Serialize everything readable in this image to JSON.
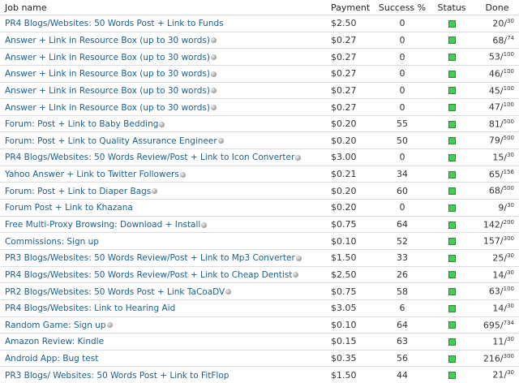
{
  "headers": {
    "job": "Job name",
    "payment": "Payment",
    "success": "Success %",
    "status": "Status",
    "done": "Done"
  },
  "colors": {
    "link": "#1a5f8b",
    "status_ok": "#44cc55"
  },
  "rows": [
    {
      "job": "PR4 Blogs/Websites: 50 Words Post + Link to Funds",
      "info": false,
      "payment": "$2.50",
      "success": "0",
      "done": "20",
      "total": "30"
    },
    {
      "job": "Answer + Link in Resource Box (up to 30 words)",
      "info": true,
      "payment": "$0.27",
      "success": "0",
      "done": "68",
      "total": "74"
    },
    {
      "job": "Answer + Link in Resource Box (up to 30 words)",
      "info": true,
      "payment": "$0.27",
      "success": "0",
      "done": "53",
      "total": "100"
    },
    {
      "job": "Answer + Link in Resource Box (up to 30 words)",
      "info": true,
      "payment": "$0.27",
      "success": "0",
      "done": "46",
      "total": "100"
    },
    {
      "job": "Answer + Link in Resource Box (up to 30 words)",
      "info": true,
      "payment": "$0.27",
      "success": "0",
      "done": "45",
      "total": "100"
    },
    {
      "job": "Answer + Link in Resource Box (up to 30 words)",
      "info": true,
      "payment": "$0.27",
      "success": "0",
      "done": "47",
      "total": "100"
    },
    {
      "job": "Forum: Post + Link to Baby Bedding",
      "info": true,
      "payment": "$0.20",
      "success": "55",
      "done": "81",
      "total": "500"
    },
    {
      "job": "Forum: Post + Link to Quality Assurance Engineer",
      "info": true,
      "payment": "$0.20",
      "success": "50",
      "done": "79",
      "total": "500"
    },
    {
      "job": "PR4 Blogs/Websites: 50 Words Review/Post + Link to Icon Converter",
      "info": true,
      "payment": "$3.00",
      "success": "0",
      "done": "15",
      "total": "30"
    },
    {
      "job": "Yahoo Answer + Link to Twitter Followers",
      "info": true,
      "payment": "$0.21",
      "success": "34",
      "done": "65",
      "total": "156"
    },
    {
      "job": "Forum: Post + Link to Diaper Bags",
      "info": true,
      "payment": "$0.20",
      "success": "60",
      "done": "68",
      "total": "500"
    },
    {
      "job": "Forum Post + Link to Khazana",
      "info": false,
      "payment": "$0.20",
      "success": "0",
      "done": "9",
      "total": "30"
    },
    {
      "job": "Free Multi-Proxy Browsing: Download + Install",
      "info": true,
      "payment": "$0.75",
      "success": "64",
      "done": "142",
      "total": "200"
    },
    {
      "job": "Commissions: Sign up",
      "info": false,
      "payment": "$0.10",
      "success": "52",
      "done": "157",
      "total": "300"
    },
    {
      "job": "PR3 Blogs/Websites: 50 Words Review/Post + Link to Mp3 Converter",
      "info": true,
      "payment": "$1.50",
      "success": "33",
      "done": "25",
      "total": "30"
    },
    {
      "job": "PR4 Blogs/Websites: 50 Words Review/Post + Link to Cheap Dentist",
      "info": true,
      "payment": "$2.50",
      "success": "26",
      "done": "14",
      "total": "30"
    },
    {
      "job": "PR2 Blogs/Websites: 50 Words Post + Link TaCoaDV",
      "info": true,
      "payment": "$0.75",
      "success": "58",
      "done": "63",
      "total": "100"
    },
    {
      "job": "PR4 Blogs/Websites: Link to Hearing Aid",
      "info": false,
      "payment": "$3.05",
      "success": "6",
      "done": "14",
      "total": "30"
    },
    {
      "job": "Random Game: Sign up",
      "info": true,
      "payment": "$0.10",
      "success": "64",
      "done": "695",
      "total": "734"
    },
    {
      "job": "Amazon Review: Kindle",
      "info": false,
      "payment": "$0.15",
      "success": "63",
      "done": "11",
      "total": "30"
    },
    {
      "job": "Android App: Bug test",
      "info": false,
      "payment": "$0.35",
      "success": "56",
      "done": "216",
      "total": "300"
    },
    {
      "job": "PR3 Blogs/ Websites: 50 Words Post + Link to FitFlop",
      "info": false,
      "payment": "$1.50",
      "success": "44",
      "done": "21",
      "total": "30"
    }
  ]
}
